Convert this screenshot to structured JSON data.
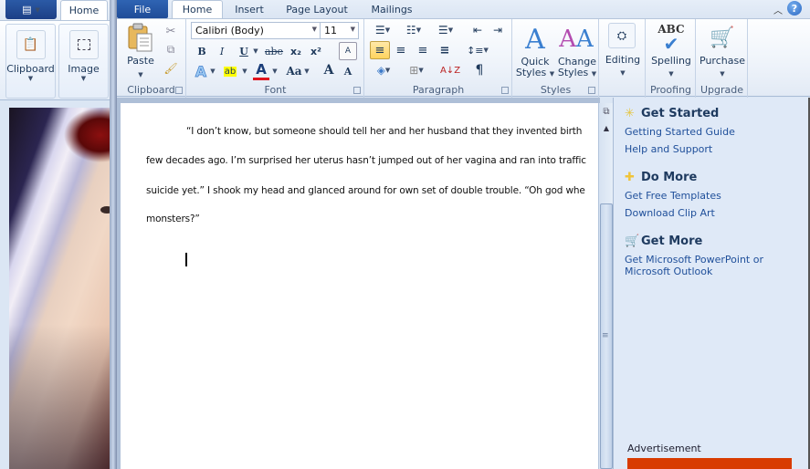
{
  "background_app": {
    "app_menu_icon": "paint-menu-icon",
    "tab_home": "Home",
    "groups": [
      {
        "label": "Clipboard",
        "icon": "clipboard-icon"
      },
      {
        "label": "Image",
        "icon": "select-icon"
      }
    ],
    "canvas_image": "portrait photo"
  },
  "word": {
    "tabs": [
      {
        "label": "File"
      },
      {
        "label": "Home",
        "active": true
      },
      {
        "label": "Insert"
      },
      {
        "label": "Page Layout"
      },
      {
        "label": "Mailings"
      }
    ],
    "ribbon": {
      "clipboard": {
        "label": "Clipboard",
        "paste": "Paste",
        "cut_icon": "scissors-icon",
        "copy_icon": "copy-icon",
        "format_painter_icon": "brush-icon"
      },
      "font": {
        "label": "Font",
        "font_name": "Calibri (Body)",
        "font_size": "11",
        "bold": "B",
        "italic": "I",
        "underline": "U",
        "strikethrough": "abe",
        "subscript": "x₂",
        "superscript": "x²",
        "clear_format": "A",
        "text_effects": "A",
        "highlight": "ab",
        "font_color": "A",
        "change_case": "Aa",
        "grow_font": "A",
        "shrink_font": "A",
        "font_color_hex": "#e0141e",
        "highlight_hex": "#ffff00"
      },
      "paragraph": {
        "label": "Paragraph",
        "pilcrow": "¶",
        "sort": "A↓Z",
        "align_left_selected": true
      },
      "styles": {
        "label": "Styles",
        "quick_styles": [
          "Quick",
          "Styles"
        ],
        "change_styles": [
          "Change",
          "Styles"
        ]
      },
      "editing": {
        "label": "Editing"
      },
      "proofing": {
        "label": "Proofing",
        "spelling": "Spelling",
        "abc": "ABC"
      },
      "upgrade": {
        "label": "Upgrade",
        "purchase": "Purchase"
      }
    },
    "document": {
      "lines": [
        "“I don’t know, but someone should tell her and her husband that they invented birth",
        "few decades ago. I’m surprised her uterus hasn’t jumped out of her vagina and ran into traffic",
        "suicide yet.” I shook my head and glanced around for own set of double trouble. “Oh god whe",
        "monsters?”"
      ]
    },
    "task_pane": {
      "sections": [
        {
          "title": "Get Started",
          "icon": "sparkle-icon",
          "links": [
            "Getting Started Guide",
            "Help and Support"
          ]
        },
        {
          "title": "Do More",
          "icon": "plus-icon",
          "links": [
            "Get Free Templates",
            "Download Clip Art"
          ]
        },
        {
          "title": "Get More",
          "icon": "cart-icon",
          "links": [
            "Get Microsoft PowerPoint or Microsoft Outlook"
          ]
        }
      ],
      "advertisement_label": "Advertisement",
      "ad_color": "#d83b01"
    }
  }
}
